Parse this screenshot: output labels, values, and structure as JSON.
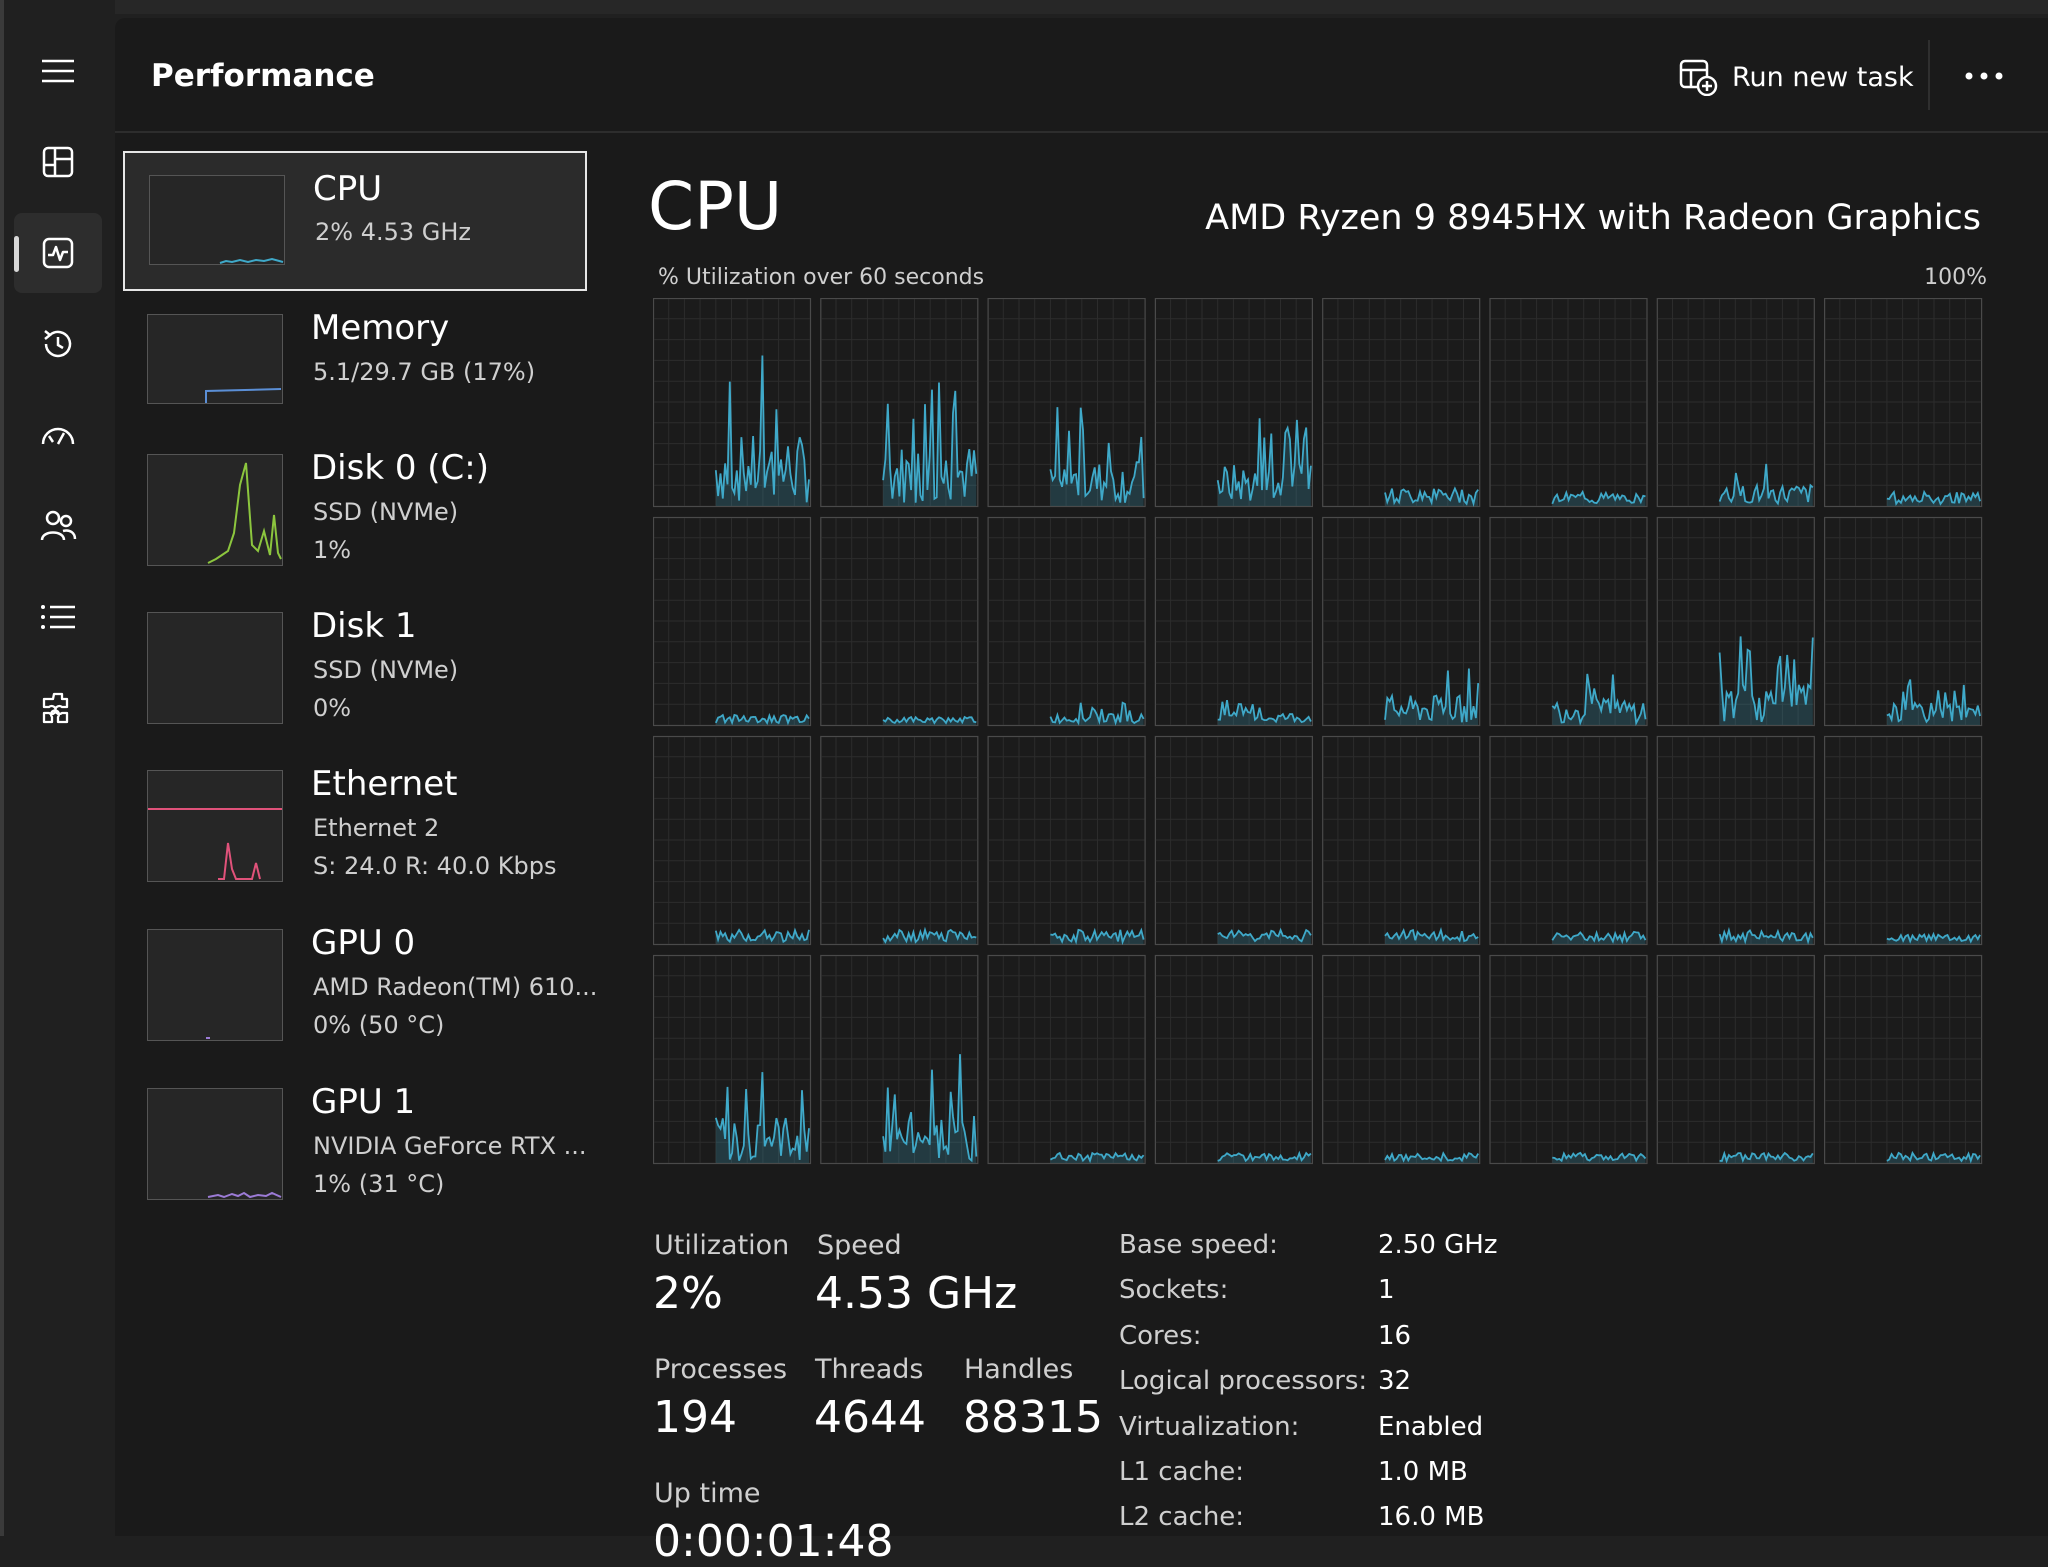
{
  "header": {
    "title": "Performance",
    "run_new_task": "Run new task"
  },
  "nav": {
    "items": [
      {
        "icon": "hamburger-menu-icon"
      },
      {
        "icon": "processes-icon"
      },
      {
        "icon": "performance-icon",
        "active": true
      },
      {
        "icon": "app-history-icon"
      },
      {
        "icon": "startup-apps-icon"
      },
      {
        "icon": "users-icon"
      },
      {
        "icon": "details-icon"
      },
      {
        "icon": "services-icon"
      }
    ]
  },
  "sidebar": {
    "items": [
      {
        "name": "CPU",
        "lines": [
          "2%  4.53 GHz"
        ],
        "color": "#3fa9c9",
        "selected": true
      },
      {
        "name": "Memory",
        "lines": [
          "5.1/29.7 GB (17%)"
        ],
        "color": "#5b8fd6"
      },
      {
        "name": "Disk 0 (C:)",
        "lines": [
          "SSD (NVMe)",
          "1%"
        ],
        "color": "#8cc63e"
      },
      {
        "name": "Disk 1",
        "lines": [
          "SSD (NVMe)",
          "0%"
        ],
        "color": "#8cc63e"
      },
      {
        "name": "Ethernet",
        "lines": [
          "Ethernet 2",
          "S: 24.0  R: 40.0 Kbps"
        ],
        "color": "#e0527a"
      },
      {
        "name": "GPU 0",
        "lines": [
          "AMD Radeon(TM) 610...",
          "0%  (50 °C)"
        ],
        "color": "#9c7bd6"
      },
      {
        "name": "GPU 1",
        "lines": [
          "NVIDIA GeForce RTX ...",
          "1%  (31 °C)"
        ],
        "color": "#9c7bd6"
      }
    ]
  },
  "main": {
    "title": "CPU",
    "model": "AMD Ryzen 9 8945HX with Radeon Graphics",
    "util_caption": "% Utilization over 60 seconds",
    "max_label": "100%",
    "graph_color": "#3fa9c9"
  },
  "stats": {
    "utilization_label": "Utilization",
    "utilization": "2%",
    "speed_label": "Speed",
    "speed": "4.53 GHz",
    "processes_label": "Processes",
    "processes": "194",
    "threads_label": "Threads",
    "threads": "4644",
    "handles_label": "Handles",
    "handles": "88315",
    "uptime_label": "Up time",
    "uptime": "0:00:01:48"
  },
  "specs": [
    {
      "k": "Base speed:",
      "v": "2.50 GHz"
    },
    {
      "k": "Sockets:",
      "v": "1"
    },
    {
      "k": "Cores:",
      "v": "16"
    },
    {
      "k": "Logical processors:",
      "v": "32"
    },
    {
      "k": "Virtualization:",
      "v": "Enabled"
    },
    {
      "k": "L1 cache:",
      "v": "1.0 MB"
    },
    {
      "k": "L2 cache:",
      "v": "16.0 MB"
    }
  ]
}
